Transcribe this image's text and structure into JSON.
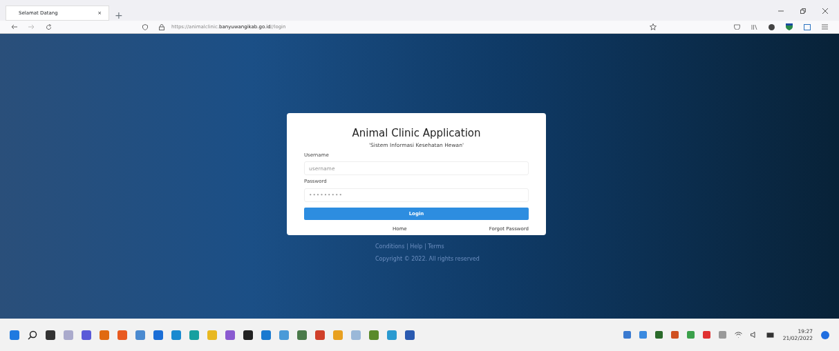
{
  "browser": {
    "tab": {
      "title": "Selamat Datang",
      "close": "×",
      "selected": true
    },
    "new_tab": "+",
    "url": {
      "prefix": "https://animalclinic.",
      "domain": "banyuwangikab.go.id",
      "path": "//login"
    }
  },
  "login": {
    "title": "Animal Clinic Application",
    "subtitle": "'Sistem Informasi Kesehatan Hewan'",
    "fields": [
      {
        "label": "Username",
        "placeholder": "username",
        "kind": "text"
      },
      {
        "label": "Password",
        "placeholder": "•••••••••",
        "kind": "password"
      }
    ],
    "button": "Login",
    "links": [
      "Home",
      "Forgot Password"
    ]
  },
  "footer": {
    "links": "Conditions | Help | Terms",
    "copyright": "Copyright © 2022. All rights reserved"
  },
  "taskbar": {
    "time": "19:27",
    "date": "21/02/2022"
  }
}
